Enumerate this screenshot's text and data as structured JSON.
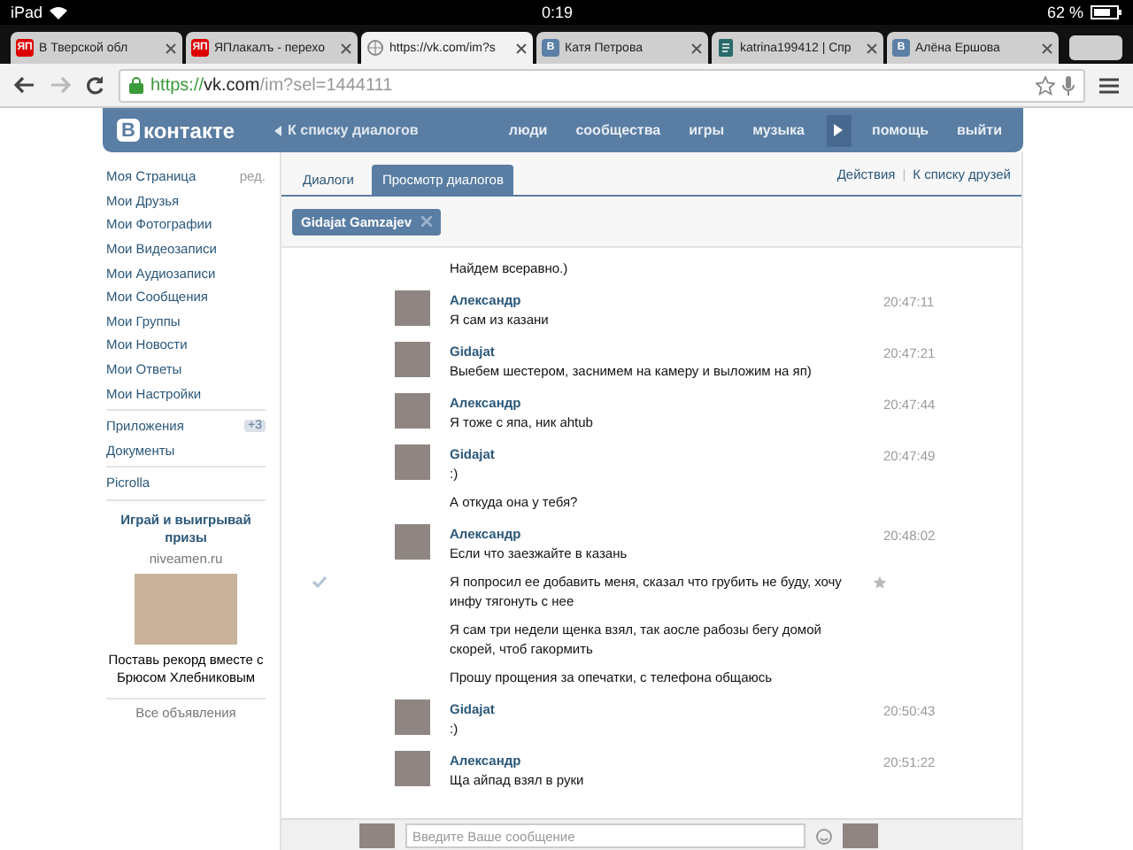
{
  "status_bar": {
    "device": "iPad",
    "time": "0:19",
    "battery": "62 %"
  },
  "browser_tabs": [
    {
      "title": "В Тверской обл",
      "kind": "badge",
      "icon_text": "ЯП",
      "color": "#dd0000",
      "selected": false
    },
    {
      "title": "ЯПлакалъ - перехо",
      "kind": "badge",
      "icon_text": "ЯП",
      "color": "#dd0000",
      "selected": false
    },
    {
      "title": "https://vk.com/im?s",
      "kind": "globe",
      "selected": true
    },
    {
      "title": "Катя Петрова",
      "kind": "badge",
      "icon_text": "В",
      "color": "#5b7fa6",
      "selected": false
    },
    {
      "title": "katrina199412 | Спр",
      "kind": "document",
      "selected": false
    },
    {
      "title": "Алёна Ершова",
      "kind": "badge",
      "icon_text": "В",
      "color": "#5b7fa6",
      "selected": false
    }
  ],
  "address_bar": {
    "scheme": "https://",
    "host": "vk.com",
    "path": "/im?sel=1444111"
  },
  "header": {
    "logo_mark": "В",
    "logo_text": "контакте",
    "back_link": "К списку диалогов",
    "nav": [
      "люди",
      "сообщества",
      "игры",
      "музыка"
    ],
    "nav_after_player": [
      "помощь",
      "выйти"
    ]
  },
  "sidebar": {
    "sections": [
      [
        {
          "label": "Моя Страница",
          "extra": "ред."
        },
        {
          "label": "Мои Друзья"
        },
        {
          "label": "Мои Фотографии"
        },
        {
          "label": "Мои Видеозаписи"
        },
        {
          "label": "Мои Аудиозаписи"
        },
        {
          "label": "Мои Сообщения"
        },
        {
          "label": "Мои Группы"
        },
        {
          "label": "Мои Новости"
        },
        {
          "label": "Мои Ответы"
        },
        {
          "label": "Мои Настройки"
        }
      ],
      [
        {
          "label": "Приложения",
          "badge": "+3"
        },
        {
          "label": "Документы"
        }
      ],
      [
        {
          "label": "Picrolla"
        }
      ]
    ],
    "ad": {
      "title": "Играй и выигрывай призы",
      "domain": "niveamen.ru",
      "text": "Поставь рекорд вместе с Брюсом Хлебниковым",
      "all_ads": "Все объявления"
    }
  },
  "dialog_tabs": [
    {
      "label": "Диалоги",
      "selected": false
    },
    {
      "label": "Просмотр диалогов",
      "selected": true
    }
  ],
  "actions": [
    "Действия",
    "К списку друзей"
  ],
  "actions_separator": "|",
  "recipient_chip": {
    "name": "Gidajat Gamzajev"
  },
  "messages": [
    {
      "lines": [
        {
          "text": "Найдем всеравно.)",
          "kind": "plain"
        }
      ]
    },
    {
      "author": "Александр",
      "time": "20:47:11",
      "lines": [
        {
          "text": "Я сам из казани",
          "kind": "plain"
        }
      ]
    },
    {
      "author": "Gidajat",
      "time": "20:47:21",
      "lines": [
        {
          "text": "Выебем шестером, заснимем на камеру и выложим на яп)",
          "kind": "plain"
        }
      ]
    },
    {
      "author": "Александр",
      "time": "20:47:44",
      "lines": [
        {
          "text": "Я тоже с япа, ник ahtub",
          "kind": "plain"
        }
      ]
    },
    {
      "author": "Gidajat",
      "time": "20:47:49",
      "lines": [
        {
          "text": ":)",
          "kind": "plain"
        },
        {
          "text": "А откуда она у тебя?",
          "kind": "plain"
        }
      ]
    },
    {
      "author": "Александр",
      "time": "20:48:02",
      "lines": [
        {
          "text": "Если что заезжайте в казань",
          "kind": "plain"
        },
        {
          "text": "Я попросил ее добавить меня, сказал что грубить не буду, хочу инфу тягонуть с нее",
          "kind": "hovered"
        },
        {
          "text": "Я сам три недели щенка взял, так аосле рабозы бегу домой скорей, чтоб гакормить",
          "kind": "plain"
        },
        {
          "text": "Прошу прощения за опечатки, с телефона общаюсь",
          "kind": "plain"
        }
      ]
    },
    {
      "author": "Gidajat",
      "time": "20:50:43",
      "lines": [
        {
          "text": ":)",
          "kind": "plain"
        }
      ]
    },
    {
      "author": "Александр",
      "time": "20:51:22",
      "lines": [
        {
          "text": "Ща айпад взял в руки",
          "kind": "plain"
        }
      ]
    }
  ],
  "composer": {
    "placeholder": "Введите Ваше сообщение"
  }
}
